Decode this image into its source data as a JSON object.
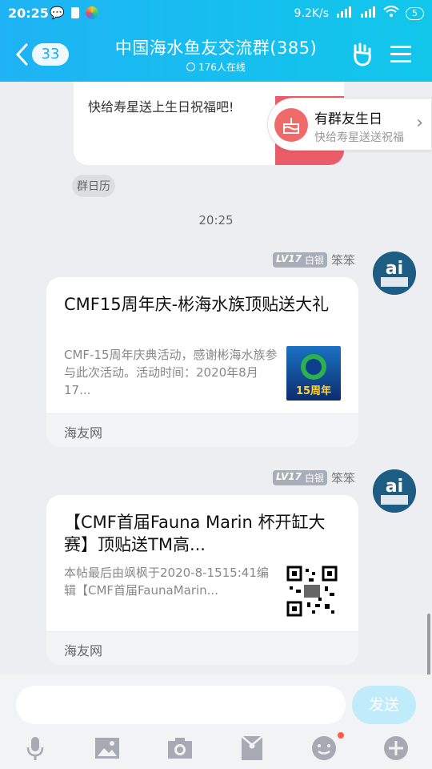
{
  "status_bar": {
    "time": "20:25",
    "network_speed": "9.2K/s",
    "battery": "5",
    "colors": {
      "text": "#ffffff"
    }
  },
  "header": {
    "back_badge": "33",
    "title": "中国海水鱼友交流群(385)",
    "subtitle": "176人在线",
    "icons": [
      "back-arrow-icon",
      "rock-hand-icon",
      "menu-icon"
    ],
    "gradient": [
      "#1fb3f5",
      "#12c6ea"
    ]
  },
  "birthday_card": {
    "text": "快给寿星送上生日祝福吧!",
    "tag": "群日历"
  },
  "birthday_popup": {
    "title": "有群友生日",
    "subtitle": "快给寿星送送祝福"
  },
  "timestamp": "20:25",
  "messages": [
    {
      "sender": {
        "level": "LV17",
        "rank": "白银",
        "name": "笨笨"
      },
      "title": "CMF15周年庆-彬海水族顶贴送大礼",
      "desc": "CMF-15周年庆典活动，感谢彬海水族参与此次活动。活动时间：2020年8月17...",
      "thumb_label": "15周年",
      "source": "海友网"
    },
    {
      "sender": {
        "level": "LV17",
        "rank": "白银",
        "name": "笨笨"
      },
      "title": "【CMF首届Fauna Marin 杯开缸大赛】顶贴送TM高...",
      "desc": "本帖最后由飒枫于2020-8-1515:41编辑【CMF首届FaunaMarin...",
      "thumb_label": "qr-code",
      "source": "海友网"
    }
  ],
  "input": {
    "placeholder": "",
    "send_label": "发送",
    "tools": [
      "microphone-icon",
      "image-icon",
      "camera-icon",
      "red-packet-icon",
      "emoji-icon",
      "plus-icon"
    ]
  },
  "avatar_label": "ai 笨笨"
}
